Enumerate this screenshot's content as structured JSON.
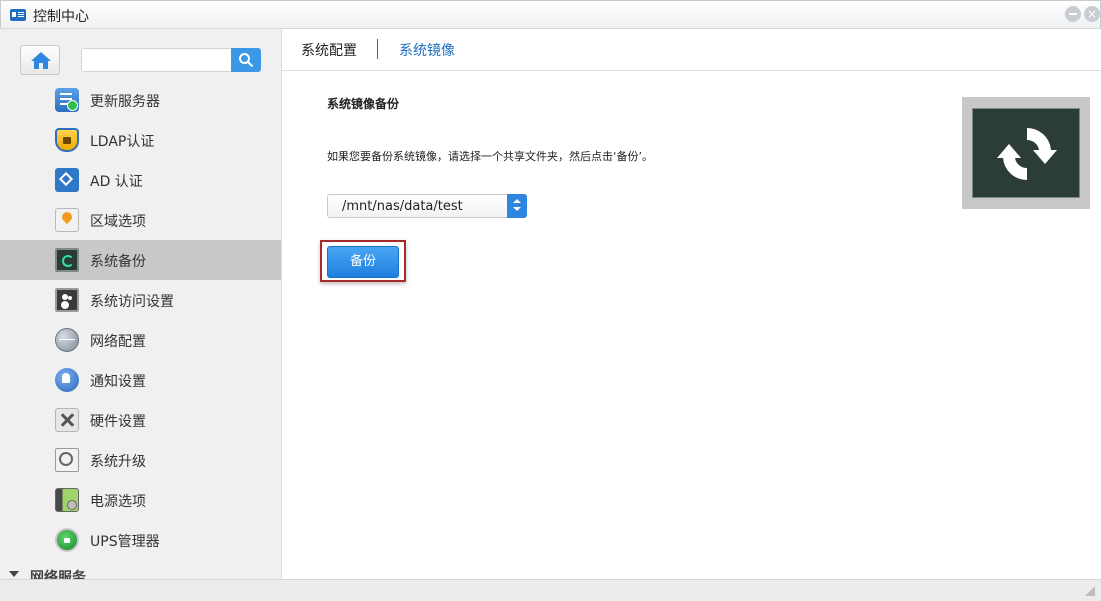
{
  "window": {
    "title": "控制中心",
    "close_glyph": "×"
  },
  "sidebar": {
    "search": {
      "placeholder": ""
    },
    "items": [
      {
        "label": "更新服务器",
        "icon": "update-server-icon"
      },
      {
        "label": "LDAP认证",
        "icon": "ldap-shield-icon"
      },
      {
        "label": "AD 认证",
        "icon": "ad-network-icon"
      },
      {
        "label": "区域选项",
        "icon": "region-pin-icon"
      },
      {
        "label": "系统备份",
        "icon": "system-backup-icon",
        "active": true
      },
      {
        "label": "系统访问设置",
        "icon": "access-users-icon"
      },
      {
        "label": "网络配置",
        "icon": "network-globe-icon"
      },
      {
        "label": "通知设置",
        "icon": "notification-bell-icon"
      },
      {
        "label": "硬件设置",
        "icon": "hardware-tools-icon"
      },
      {
        "label": "系统升级",
        "icon": "system-upgrade-icon"
      },
      {
        "label": "电源选项",
        "icon": "power-battery-icon"
      },
      {
        "label": "UPS管理器",
        "icon": "ups-manager-icon"
      }
    ],
    "section": "网络服务"
  },
  "tabs": [
    {
      "label": "系统配置",
      "active": false
    },
    {
      "label": "系统镜像",
      "active": true
    }
  ],
  "content": {
    "section_title": "系统镜像备份",
    "description": "如果您要备份系统镜像，请选择一个共享文件夹，然后点击‘备份’。",
    "folder_select": {
      "value": "/mnt/nas/data/test"
    },
    "backup_button": "备份"
  },
  "colors": {
    "accent": "#1e6fc2",
    "button": "#2f86e0",
    "highlight_frame": "#a52a2a",
    "sidebar_active": "#c8c8c8"
  }
}
